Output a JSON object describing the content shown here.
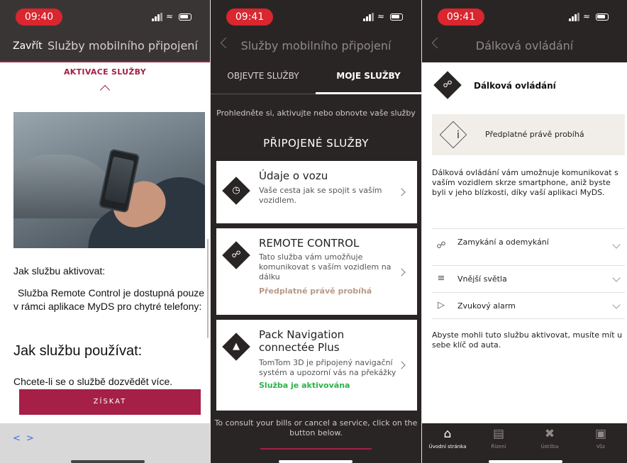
{
  "screen1": {
    "time": "09:40",
    "close_label": "Zavřít",
    "title": "Služby mobilního připojení",
    "activation_label": "AKTIVACE SLUŽBY",
    "how_activate": "Jak službu aktivovat:",
    "activate_text": "Služba Remote Control je dostupná pouze v rámci aplikace MyDS pro chytré telefony:",
    "how_use": "Jak službu používat:",
    "more_info": "Chcete-li se o službě dozvědět více.",
    "get_button": "ZÍSKAT",
    "nav_back": "<",
    "nav_forward": ">"
  },
  "screen2": {
    "time": "09:41",
    "title": "Služby mobilního připojení",
    "tabs": [
      "OBJEVTE SLUŽBY",
      "MOJE SLUŽBY"
    ],
    "active_tab": 1,
    "intro": "Prohledněte si, aktivujte nebo obnovte vaše služby",
    "section_title": "PŘIPOJENÉ SLUŽBY",
    "cards": [
      {
        "title": "Údaje o vozu",
        "desc": "Vaše cesta jak se spojit s vaším vozidlem.",
        "status": "",
        "status_color": "",
        "icon": "gauge-icon"
      },
      {
        "title": "REMOTE CONTROL",
        "desc": "Tato služba vám umožňuje komunikovat s vaším vozidlem na dálku",
        "status": "Předplatné právě probíhá",
        "status_color": "#b79a86",
        "icon": "remote-lock-icon"
      },
      {
        "title": "Pack Navigation connectée Plus",
        "desc": "TomTom 3D je připojený navigační systém a upozorní vás na překážky",
        "status": "Služba je aktivována",
        "status_color": "#2db24a",
        "icon": "navigation-arrow-icon"
      }
    ],
    "footer": "To consult your bills or cancel a service, click on the button below."
  },
  "screen3": {
    "time": "09:41",
    "title": "Dálková ovládání",
    "header_title": "Dálková ovládání",
    "banner_text": "Předplatné právě probíhá",
    "description": "Dálková ovládání vám umožnuje komunikovat s vaším vozidlem skrze smartphone, aniž byste byli v jeho blízkosti, díky vaší aplikaci MyDS.",
    "features": [
      {
        "label": "Zamykání a odemykání",
        "icon": "lock-icon"
      },
      {
        "label": "Vnější světla",
        "icon": "headlight-icon"
      },
      {
        "label": "Zvukový alarm",
        "icon": "horn-icon"
      }
    ],
    "note": "Abyste mohli tuto službu aktivovat, musíte mít u sebe klíč od auta.",
    "tabbar": [
      {
        "label": "Úvodní stránka",
        "icon": "home-icon"
      },
      {
        "label": "Řízení",
        "icon": "chart-icon"
      },
      {
        "label": "Údržba",
        "icon": "tools-icon"
      },
      {
        "label": "Vůz",
        "icon": "car-icon"
      }
    ],
    "active_tab": 0
  },
  "colors": {
    "accent": "#a51f46",
    "dark": "#2a2525",
    "status_pill": "#d9262f",
    "active_green": "#2db24a",
    "pending_tan": "#b79a86"
  }
}
